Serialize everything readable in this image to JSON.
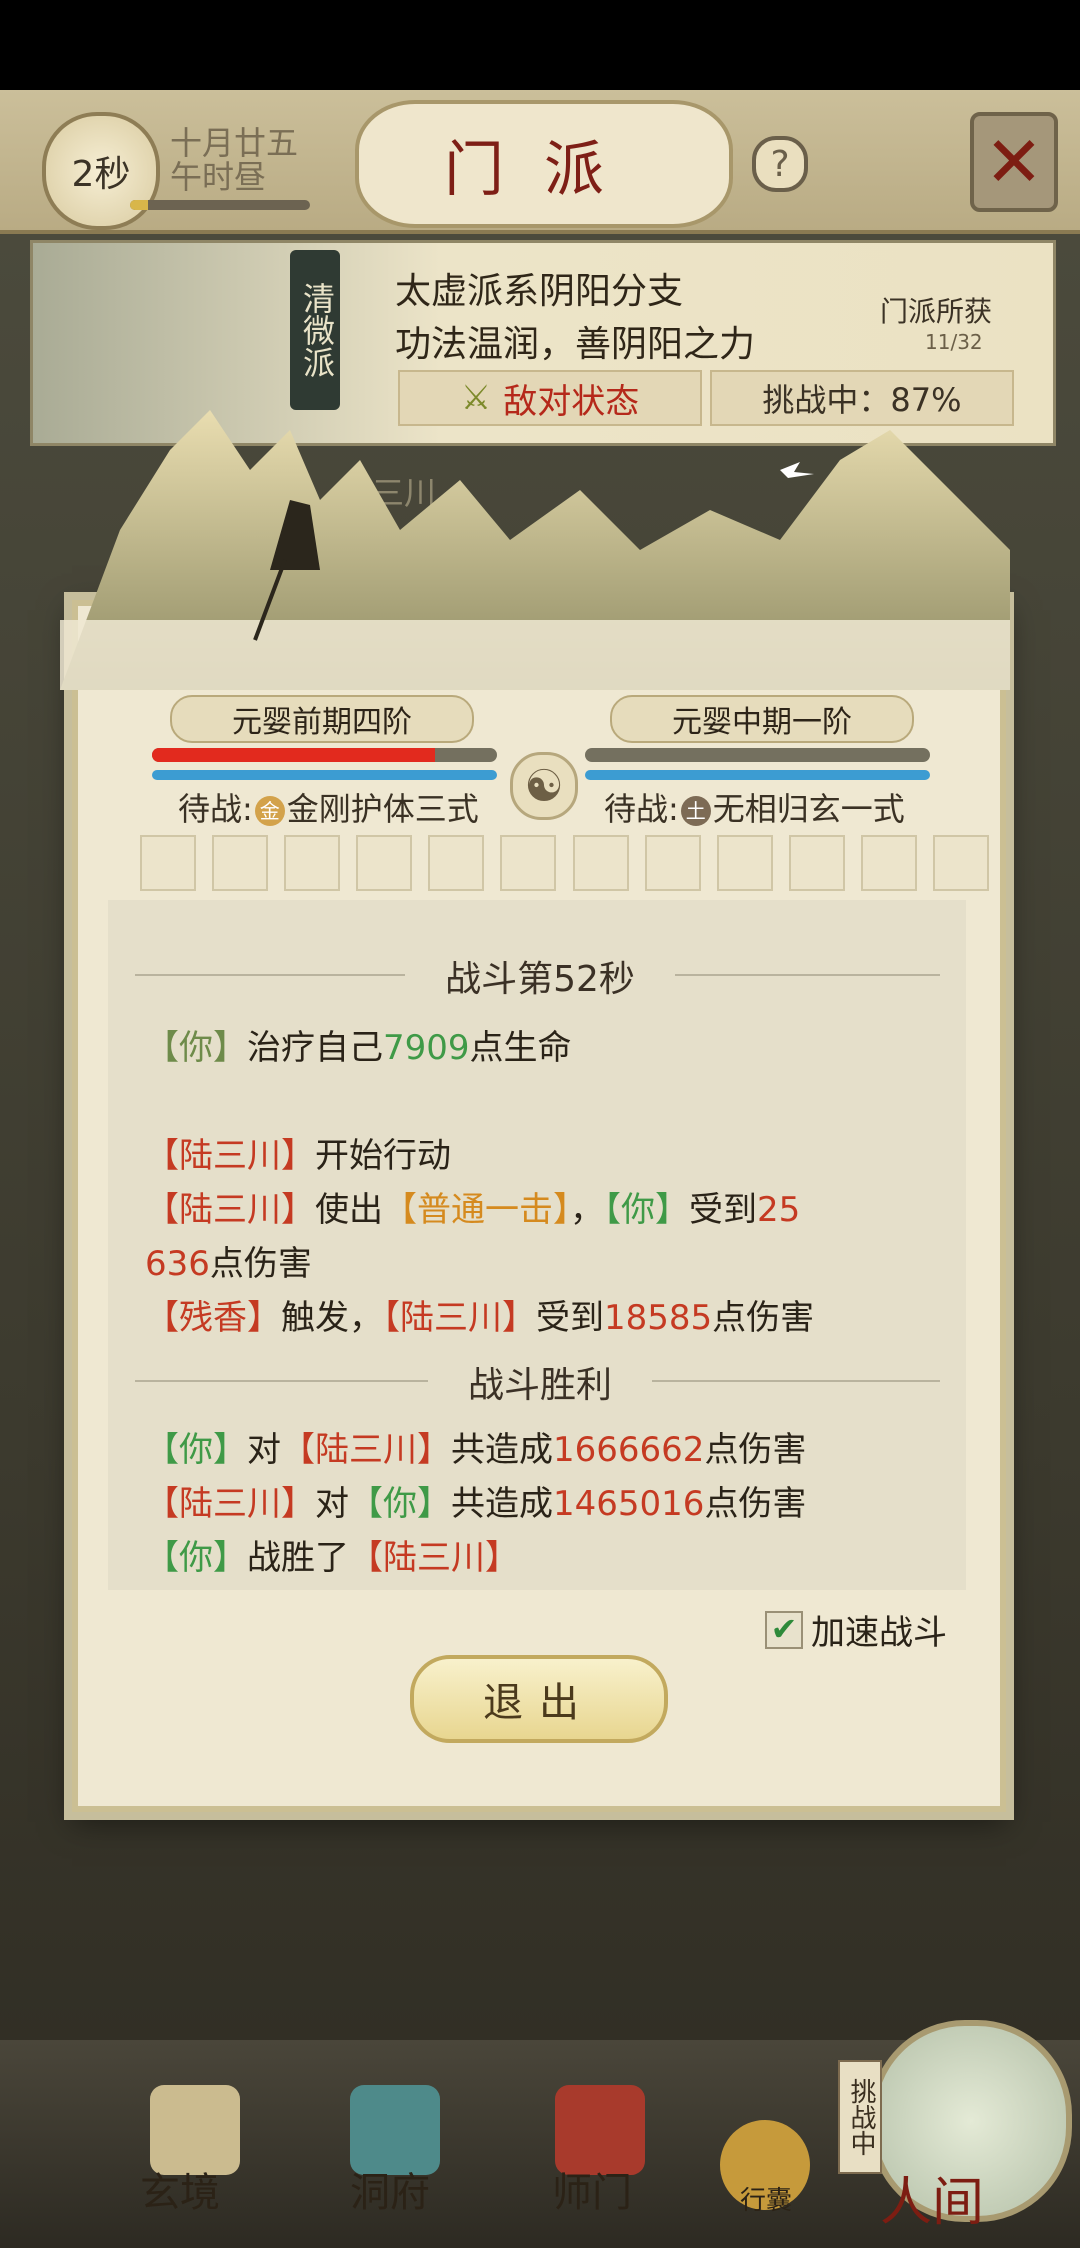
{
  "topbar": {
    "timer": "2秒",
    "date_line1": "十月廿五",
    "date_line2": "午时昼",
    "time_progress": 0.1,
    "title": "门派",
    "help_icon": "?",
    "close_icon": "close-icon"
  },
  "sect": {
    "seal": "清微派",
    "desc1": "太虚派系阴阳分支",
    "desc2": "功法温润，善阴阳之力",
    "hostile": "敌对状态",
    "challenge": "挑战中：87%",
    "gains": "门派所获",
    "gains_count": "11/32",
    "opponent_behind": "陆三川"
  },
  "battle": {
    "left_rank": "元婴前期四阶",
    "right_rank": "元婴中期一阶",
    "left_hp": 0.82,
    "left_mp": 1.0,
    "right_hp": 0.0,
    "right_mp": 1.0,
    "left_wait_label": "待战:",
    "left_elem": "金",
    "left_skill": "金刚护体三式",
    "right_wait_label": "待战:",
    "right_elem": "土",
    "right_skill": "无相归玄一式"
  },
  "log": {
    "header": "战斗第52秒",
    "l1": {
      "b1": "【你】",
      "t1": "治疗自己",
      "n1": "7909",
      "t2": "点生命"
    },
    "l2": {
      "b1": "【陆三川】",
      "t1": "开始行动"
    },
    "l3": {
      "b1": "【陆三川】",
      "t1": "使出",
      "b2": "【普通一击】",
      "t2": "，",
      "b3": "【你】",
      "t3": "受到",
      "n1": "25"
    },
    "l4": {
      "n1": "636",
      "t1": "点伤害"
    },
    "l5": {
      "b1": "【残香】",
      "t1": "触发，",
      "b2": "【陆三川】",
      "t2": "受到",
      "n1": "18585",
      "t3": "点伤害"
    },
    "result": "战斗胜利",
    "l6": {
      "b1": "【你】",
      "t1": "对",
      "b2": "【陆三川】",
      "t2": "共造成",
      "n1": "1666662",
      "t3": "点伤害"
    },
    "l7": {
      "b1": "【陆三川】",
      "t1": "对",
      "b2": "【你】",
      "t2": "共造成",
      "n1": "1465016",
      "t3": "点伤害"
    },
    "l8": {
      "b1": "【你】",
      "t1": "战胜了",
      "b2": "【陆三川】"
    }
  },
  "controls": {
    "accelerate": "加速战斗",
    "accelerate_checked": true,
    "exit": "退出"
  },
  "nav": {
    "xuanjing": "玄境",
    "dongfu": "洞府",
    "shimen": "师门",
    "xingnang": "行囊",
    "challenge_tag": "挑战中",
    "renjian": "人间"
  },
  "colors": {
    "you": "#3f9a47",
    "enemy": "#c53a22",
    "skill": "#d58a1e",
    "hp": "#e22a1e",
    "mp": "#3c9cd2"
  }
}
